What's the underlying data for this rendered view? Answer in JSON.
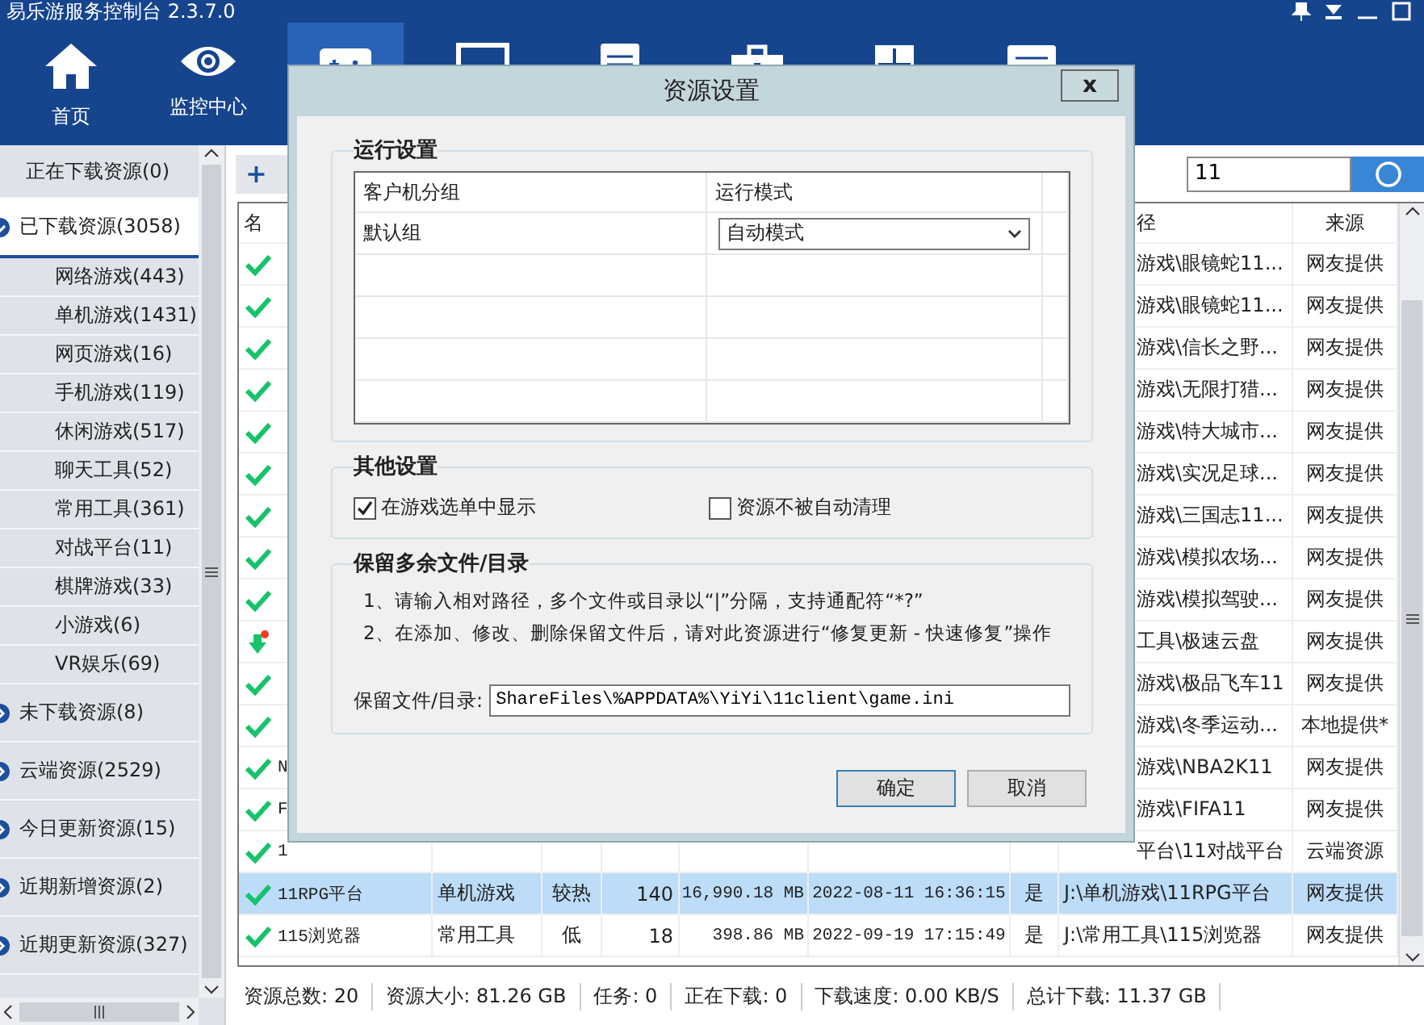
{
  "app": {
    "title": "易乐游服务控制台 2.3.7.0"
  },
  "toolbar": [
    {
      "kind": "home",
      "label": "首页",
      "selected": false
    },
    {
      "kind": "eye",
      "label": "监控中心",
      "selected": false
    },
    {
      "kind": "gamepad",
      "selected": true
    },
    {
      "kind": "monitor",
      "selected": false
    },
    {
      "kind": "document",
      "selected": false
    },
    {
      "kind": "toolbox",
      "selected": false
    },
    {
      "kind": "shield",
      "selected": false
    },
    {
      "kind": "card",
      "selected": false
    }
  ],
  "sidebar": {
    "items": [
      {
        "label": "正在下载资源(0)",
        "selected": false
      },
      {
        "label": "已下载资源(3058)",
        "selected": true,
        "expanded": true,
        "children": [
          {
            "label": "网络游戏(443)"
          },
          {
            "label": "单机游戏(1431)"
          },
          {
            "label": "网页游戏(16)"
          },
          {
            "label": "手机游戏(119)"
          },
          {
            "label": "休闲游戏(517)"
          },
          {
            "label": "聊天工具(52)"
          },
          {
            "label": "常用工具(361)"
          },
          {
            "label": "对战平台(11)"
          },
          {
            "label": "棋牌游戏(33)"
          },
          {
            "label": "小游戏(6)"
          },
          {
            "label": "VR娱乐(69)"
          }
        ]
      },
      {
        "label": "未下载资源(8)",
        "selected": false,
        "expanded": false
      },
      {
        "label": "云端资源(2529)",
        "selected": false,
        "expanded": false
      },
      {
        "label": "今日更新资源(15)",
        "selected": false,
        "expanded": false
      },
      {
        "label": "近期新增资源(2)",
        "selected": false,
        "expanded": false
      },
      {
        "label": "近期更新资源(327)",
        "selected": false,
        "expanded": false
      }
    ]
  },
  "actions": {
    "add_icon": "+"
  },
  "search": {
    "value": "11"
  },
  "table": {
    "columns": {
      "name": "名",
      "path": "径",
      "source": "来源"
    },
    "rows": [
      {
        "kind": "done",
        "selected": false,
        "path": "游戏\\眼镜蛇11...",
        "source": "网友提供"
      },
      {
        "kind": "done",
        "selected": false,
        "path": "游戏\\眼镜蛇11...",
        "source": "网友提供"
      },
      {
        "kind": "done",
        "selected": false,
        "path": "游戏\\信长之野...",
        "source": "网友提供"
      },
      {
        "kind": "done",
        "selected": false,
        "path": "游戏\\无限打猎...",
        "source": "网友提供"
      },
      {
        "kind": "done",
        "selected": false,
        "path": "游戏\\特大城市...",
        "source": "网友提供"
      },
      {
        "kind": "done",
        "selected": false,
        "path": "游戏\\实况足球...",
        "source": "网友提供"
      },
      {
        "kind": "done",
        "selected": false,
        "path": "游戏\\三国志11...",
        "source": "网友提供"
      },
      {
        "kind": "done",
        "selected": false,
        "path": "游戏\\模拟农场...",
        "source": "网友提供"
      },
      {
        "kind": "done",
        "selected": false,
        "path": "游戏\\模拟驾驶...",
        "source": "网友提供"
      },
      {
        "kind": "downloading",
        "selected": false,
        "path": "工具\\极速云盘",
        "source": "网友提供"
      },
      {
        "kind": "done",
        "selected": false,
        "path": "游戏\\极品飞车11",
        "source": "网友提供"
      },
      {
        "kind": "done",
        "selected": false,
        "path": "游戏\\冬季运动...",
        "source": "本地提供*"
      },
      {
        "kind": "done",
        "selected": false,
        "name": "N",
        "path": "游戏\\NBA2K11",
        "source": "网友提供"
      },
      {
        "kind": "done",
        "selected": false,
        "name": "F",
        "path": "游戏\\FIFA11",
        "source": "网友提供"
      },
      {
        "kind": "done",
        "selected": false,
        "name": "1",
        "path": "平台\\11对战平台",
        "source": "云端资源"
      },
      {
        "kind": "done",
        "selected": true,
        "name": "11RPG平台",
        "type": "单机游戏",
        "heat": "较热",
        "count": "140",
        "size": "16,990.18 MB",
        "date": "2022-08-11 16:36:15",
        "flag": "是",
        "path": "J:\\单机游戏\\11RPG平台",
        "source": "网友提供"
      },
      {
        "kind": "done",
        "selected": false,
        "name": "115浏览器",
        "type": "常用工具",
        "heat": "低",
        "count": "18",
        "size": "398.86 MB",
        "date": "2022-09-19 17:15:49",
        "flag": "是",
        "path": "J:\\常用工具\\115浏览器",
        "source": "网友提供"
      }
    ]
  },
  "status_bar": [
    "资源总数: 20",
    "资源大小: 81.26 GB",
    "任务: 0",
    "正在下载: 0",
    "下载速度: 0.00 KB/S",
    "总计下载: 11.37 GB"
  ],
  "dialog": {
    "title": "资源设置",
    "close": "x",
    "run_settings": {
      "title": "运行设置",
      "columns": [
        "客户机分组",
        "运行模式"
      ],
      "rows": [
        {
          "group": "默认组",
          "mode": "自动模式"
        }
      ]
    },
    "other_settings": {
      "title": "其他设置",
      "options": [
        {
          "label": "在游戏选单中显示",
          "checked": true
        },
        {
          "label": "资源不被自动清理",
          "checked": false
        }
      ]
    },
    "keep_files": {
      "title": "保留多余文件/目录",
      "notes": [
        "1、请输入相对路径，多个文件或目录以“|”分隔，支持通配符“*?”",
        "2、在添加、修改、删除保留文件后，请对此资源进行“修复更新 - 快速修复”操作"
      ],
      "field_label": "保留文件/目录:",
      "value": "ShareFiles\\%APPDATA%\\YiYi\\11client\\game.ini"
    },
    "buttons": [
      {
        "label": "确定",
        "default": true
      },
      {
        "label": "取消",
        "default": false
      }
    ]
  }
}
